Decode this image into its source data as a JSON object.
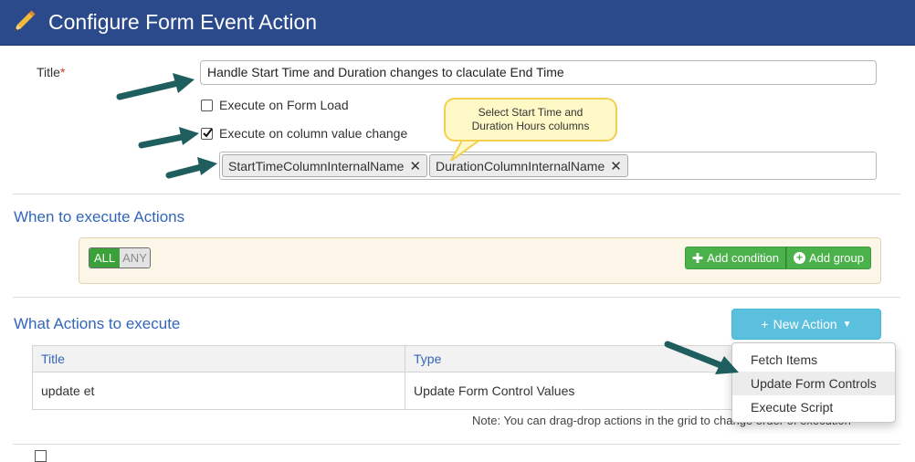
{
  "dialog": {
    "title": "Configure Form Event Action",
    "icon": "pencil-icon",
    "header_color": "#2a4a8c"
  },
  "form": {
    "title_label": "Title",
    "required_mark": "*",
    "title_value": "Handle Start Time and Duration changes to claculate End Time",
    "execute_on_load": {
      "label": "Execute on Form Load",
      "checked": false
    },
    "execute_on_change": {
      "label": "Execute on column value change",
      "checked": true
    },
    "columns": [
      {
        "label": "StartTimeColumnInternalName"
      },
      {
        "label": "DurationColumnInternalName"
      }
    ],
    "remove_glyph": "✕"
  },
  "callout": {
    "line1": "Select Start Time and",
    "line2": "Duration Hours columns"
  },
  "when_section": {
    "title": "When to execute Actions",
    "all_label": "ALL",
    "any_label": "ANY",
    "add_condition_label": "Add condition",
    "add_group_label": "Add group"
  },
  "what_section": {
    "title": "What Actions to execute",
    "new_action_label": "New Action",
    "grid_headers": [
      "Title",
      "Type"
    ],
    "rows": [
      {
        "title": "update et",
        "type": "Update Form Control Values"
      }
    ],
    "note": "Note: You can drag-drop actions in the grid to change order of execution"
  },
  "new_action_menu": {
    "items": [
      "Fetch Items",
      "Update Form Controls",
      "Execute Script"
    ],
    "highlighted": "Update Form Controls"
  },
  "colors": {
    "accent_blue": "#3366b8",
    "green": "#4bb14a",
    "info": "#5bc0de",
    "arrow": "#1f5e5e"
  }
}
